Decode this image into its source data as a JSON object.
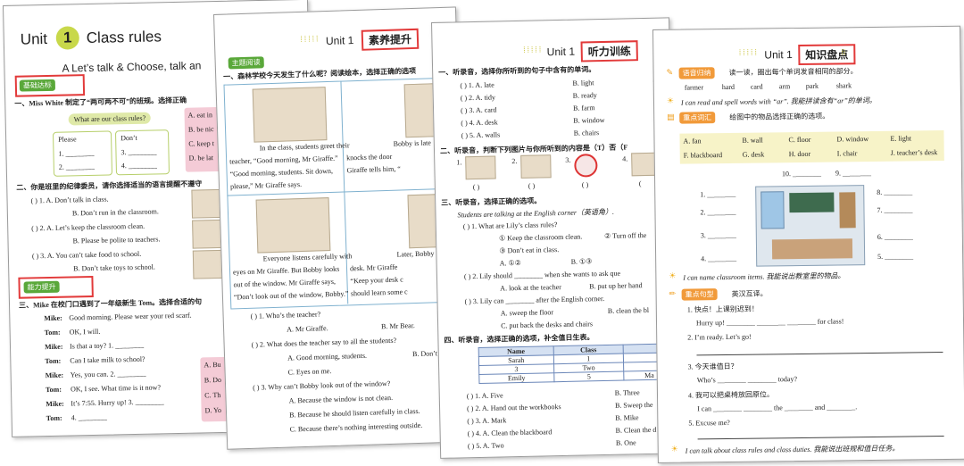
{
  "p1": {
    "unit": "Unit",
    "num": "1",
    "title": "Class rules",
    "sectionA": "A   Let’s talk & Choose, talk an",
    "badge1": "基础达标",
    "q1": "一、Miss White 制定了“两可两不可”的班规。选择正确",
    "bubble": "What are our class rules?",
    "please": "Please",
    "dont": "Don’t",
    "l1": "1. ________",
    "l2": "2. ________",
    "l3": "3. ________",
    "l4": "4. ________",
    "pink": [
      "A. eat in",
      "B. be nic",
      "C. keep t",
      "D. be lat"
    ],
    "q2": "二、你是班里的纪律委员，请你选择适当的语言提醒不遵守",
    "q2items": [
      "(     ) 1. A. Don’t talk in class.",
      "B. Don’t run in the classroom.",
      "(     ) 2. A. Let’s keep the classroom clean.",
      "B. Please be polite to teachers.",
      "(     ) 3. A. You can’t take food to school.",
      "B. Don’t take toys to school."
    ],
    "badge2": "能力提升",
    "q3": "三、Mike 在校门口遇到了一年级新生 Tom。选择合适的句",
    "dialog": [
      {
        "sp": "Mike:",
        "tx": "Good morning. Please wear your red scarf."
      },
      {
        "sp": "Tom:",
        "tx": "OK, I will."
      },
      {
        "sp": "Mike:",
        "tx": "Is that a toy? 1. ________"
      },
      {
        "sp": "Tom:",
        "tx": "Can I take milk to school?"
      },
      {
        "sp": "Mike:",
        "tx": "Yes, you can. 2. ________"
      },
      {
        "sp": "Tom:",
        "tx": "OK, I see. What time is it now?"
      },
      {
        "sp": "Mike:",
        "tx": "It’s 7:55. Hurry up! 3. ________"
      },
      {
        "sp": "Tom:",
        "tx": "4. ________"
      }
    ],
    "pink2": [
      "A. Bu",
      "B. Do",
      "C. Th",
      "D. Yo"
    ]
  },
  "p2": {
    "unit": "Unit 1",
    "tag": "素养提升",
    "badge": "主题阅读",
    "q1": "一、森林学校今天发生了什么呢？阅读绘本，选择正确的选项",
    "s1": [
      "In the class, students greet their",
      "teacher, “Good morning, Mr Giraffe.”",
      "“Good morning, students. Sit down,",
      "please,” Mr Giraffe says."
    ],
    "s2": [
      "Bobby is late",
      "knocks the door",
      "Giraffe tells him, “",
      ""
    ],
    "s3": [
      "Everyone listens carefully with",
      "eyes on Mr Giraffe. But Bobby looks",
      "out of the window. Mr Giraffe says,",
      "“Don’t look out of the window, Bobby.”"
    ],
    "s4": [
      "Later, Bobby",
      "desk. Mr Giraffe",
      "“Keep your desk c",
      "should learn some c"
    ],
    "qs": [
      "(     ) 1. Who’s the teacher?",
      "A. Mr Giraffe.",
      "B. Mr Bear.",
      "(     ) 2. What does the teacher say to all the students?",
      "A. Good morning, students.",
      "B. Don’t",
      "C. Eyes on me.",
      "(     ) 3. Why can’t Bobby look out of the window?",
      "A. Because the window is not clean.",
      "B. Because he should listen carefully in class.",
      "C. Because there’s nothing interesting outside."
    ]
  },
  "p3": {
    "unit": "Unit 1",
    "tag": "听力训练",
    "q1": "一、听录音，选择你所听到的句子中含有的单词。",
    "rows": [
      [
        "(     ) 1. A. late",
        "B. light",
        "C"
      ],
      [
        "(     ) 2. A. tidy",
        "B. ready",
        "C"
      ],
      [
        "(     ) 3. A. card",
        "B. farm",
        "C"
      ],
      [
        "(     ) 4. A. desk",
        "B. window",
        "C"
      ],
      [
        "(     ) 5. A. walls",
        "B. chairs",
        "C"
      ]
    ],
    "q2": "二、听录音，判断下列图片与你所听到的内容是（T）否（F",
    "nums": [
      "1.",
      "2.",
      "3.",
      "4."
    ],
    "parens": [
      "(     )",
      "(     )",
      "(     )",
      "("
    ],
    "q3": "三、听录音，选择正确的选项。",
    "intro": "Students are talking at the English corner（英语角）.",
    "q3items": [
      "(     ) 1. What are Lily’s class rules?",
      "① Keep the classroom clean.",
      "② Turn off the",
      "③ Don’t eat in class.",
      "A. ①②",
      "B. ①③",
      "(     ) 2. Lily should ________ when she wants to ask que",
      "A. look at the teacher",
      "B. put up her hand",
      "(     ) 3. Lily can ________ after the English corner.",
      "A. sweep the floor",
      "B. clean the bl",
      "C. put back the desks and chairs"
    ],
    "q4": "四、听录音，选择正确的选项，补全值日生表。",
    "tblHead": [
      "Name",
      "Class",
      ""
    ],
    "tblRows": [
      [
        "Sarah",
        "1",
        ""
      ],
      [
        "3",
        "Two",
        ""
      ],
      [
        "Emily",
        "5",
        "Ma"
      ]
    ],
    "q4rows": [
      [
        "(     ) 1. A. Five",
        "B. Three"
      ],
      [
        "(     ) 2. A. Hand out the workbooks",
        "B. Sweep the"
      ],
      [
        "(     ) 3. A. Mark",
        "B. Mike"
      ],
      [
        "(     ) 4. A. Clean the blackboard",
        "B. Clean the d"
      ],
      [
        "(     ) 5. A. Two",
        "B. One"
      ]
    ]
  },
  "p4": {
    "unit": "Unit 1",
    "tag": "知识盘点",
    "b1": "语音归纳",
    "b1t": "读一读，圈出每个单词发音相同的部分。",
    "words1": [
      "farmer",
      "hard",
      "card",
      "arm",
      "park",
      "shark"
    ],
    "can1": "I can read and spell words with “ar”. 我能拼读含有“ar”的单词。",
    "b2": "重点词汇",
    "b2t": "给图中的物品选择正确的选项。",
    "vocab": [
      "A. fan",
      "B. wall",
      "C. floor",
      "D. window",
      "E. light",
      "F. blackboard",
      "G. desk",
      "H. door",
      "I. chair",
      "J. teacher’s desk"
    ],
    "picl": [
      "10. ________",
      "9. ________"
    ],
    "left": [
      "1. ________",
      "2. ________",
      "3. ________",
      "4. ________"
    ],
    "right": [
      "8. ________",
      "7. ________",
      "6. ________",
      "5. ________"
    ],
    "can2": "I can name classroom items. 我能说出教室里的物品。",
    "b3": "重点句型",
    "b3t": "英汉互译。",
    "sent": [
      "1. 快点！上课别迟到！",
      "Hurry up! ________ ________ ________ for class!",
      "2. I’m ready. Let’s go!",
      "3. 今天谁值日？",
      "Who’s ________ ________ today?",
      "4. 我可以把桌椅放回原位。",
      "I can ________ ________ the ________ and ________.",
      "5. Excuse me?"
    ],
    "can3": "I can talk about class rules and class duties. 我能说出班规和值日任务。"
  }
}
